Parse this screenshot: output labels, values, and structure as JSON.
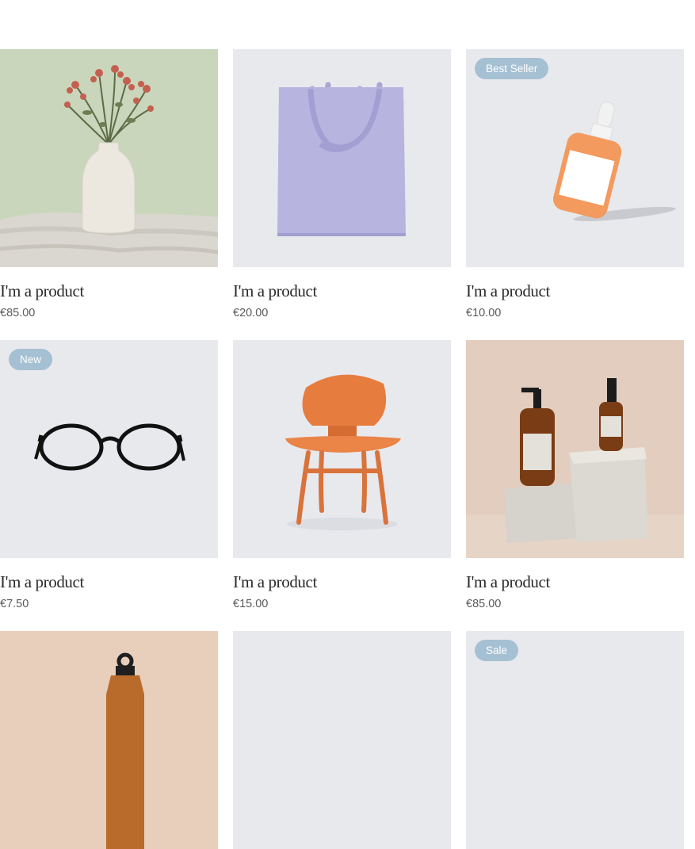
{
  "products": [
    {
      "title": "I'm a product",
      "price": "€85.00",
      "badge": null,
      "image": "dried-flowers-vase"
    },
    {
      "title": "I'm a product",
      "price": "€20.00",
      "badge": null,
      "image": "lavender-tote-bag"
    },
    {
      "title": "I'm a product",
      "price": "€10.00",
      "badge": "Best Seller",
      "image": "serum-dropper-bottle"
    },
    {
      "title": "I'm a product",
      "price": "€7.50",
      "badge": "New",
      "image": "eyeglasses"
    },
    {
      "title": "I'm a product",
      "price": "€15.00",
      "badge": null,
      "image": "wooden-chair"
    },
    {
      "title": "I'm a product",
      "price": "€85.00",
      "badge": null,
      "image": "amber-pump-bottles"
    },
    {
      "title": null,
      "price": null,
      "badge": null,
      "image": "amber-water-bottle"
    },
    {
      "title": null,
      "price": null,
      "badge": null,
      "image": "blank"
    },
    {
      "title": null,
      "price": null,
      "badge": "Sale",
      "image": "blank"
    }
  ],
  "colors": {
    "badge_background": "#a5c0d2",
    "image_background": "#e8e9ed",
    "title_text": "#2a2a2a",
    "price_text": "#5a5a5a"
  }
}
